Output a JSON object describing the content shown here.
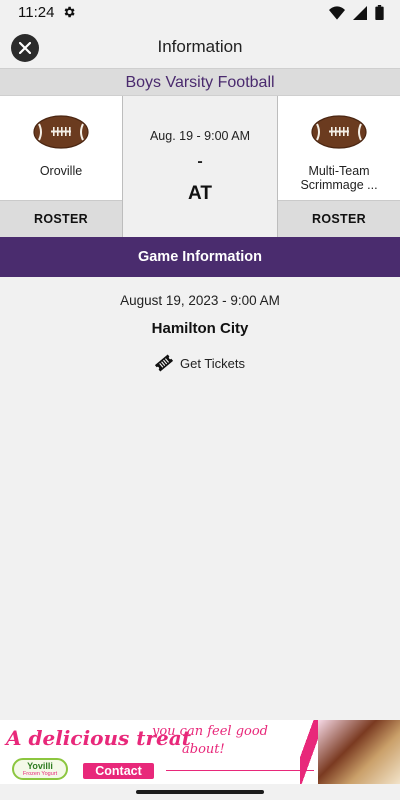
{
  "status_bar": {
    "time": "11:24",
    "icons": [
      "gear-icon",
      "wifi-icon",
      "signal-icon",
      "battery-icon"
    ]
  },
  "header": {
    "title": "Information",
    "close_icon": "close-icon"
  },
  "sport": "Boys Varsity Football",
  "matchup": {
    "home_team": {
      "name": "Oroville",
      "roster_label": "ROSTER",
      "icon": "football-icon"
    },
    "away_team": {
      "name": "Multi-Team Scrimmage ...",
      "roster_label": "ROSTER",
      "icon": "football-icon"
    },
    "short_date": "Aug. 19 - 9:00 AM",
    "score_separator": "-",
    "vs_label": "AT"
  },
  "game_info": {
    "heading": "Game Information",
    "full_date": "August 19, 2023 - 9:00 AM",
    "location": "Hamilton City",
    "tickets_label": "Get Tickets",
    "tickets_icon": "ticket-icon"
  },
  "ad_banner": {
    "tagline_main": "A delicious treat",
    "tagline_part2": "you can feel good",
    "tagline_part3": "about!",
    "brand": "Yovilli",
    "brand_sub": "Frozen Yogurt",
    "contact_label": "Contact"
  },
  "colors": {
    "accent_purple": "#4a2c6e",
    "ad_pink": "#e8287a"
  }
}
